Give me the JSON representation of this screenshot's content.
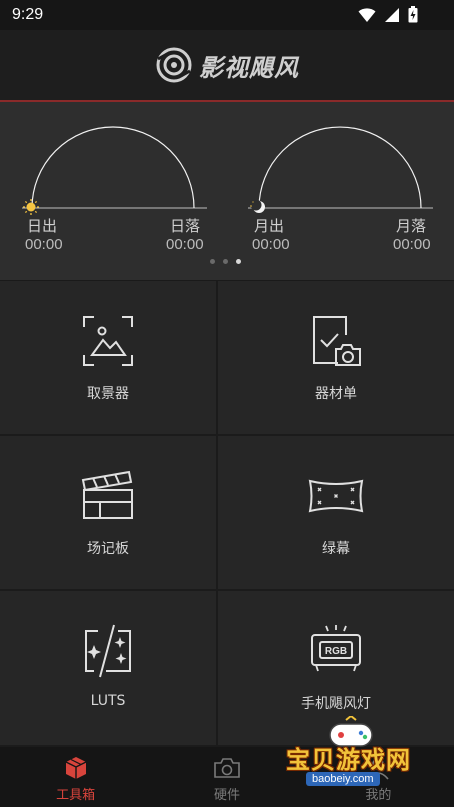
{
  "status_bar": {
    "time": "9:29",
    "icons": [
      "wifi-icon",
      "signal-icon",
      "battery-charging-icon"
    ]
  },
  "header": {
    "logo_text": "影视飓风",
    "accent_line_color": "#8a2a2a"
  },
  "sky": {
    "sun": {
      "rise_label": "日出",
      "set_label": "日落",
      "rise_time": "00:00",
      "set_time": "00:00"
    },
    "moon": {
      "rise_label": "月出",
      "set_label": "月落",
      "rise_time": "00:00",
      "set_time": "00:00"
    },
    "page_indicator": {
      "count": 3,
      "active_index": 2
    }
  },
  "tools": [
    {
      "label": "取景器",
      "icon": "viewfinder-icon"
    },
    {
      "label": "器材单",
      "icon": "gear-list-icon"
    },
    {
      "label": "场记板",
      "icon": "clapperboard-icon"
    },
    {
      "label": "绿幕",
      "icon": "green-screen-icon"
    },
    {
      "label": "LUTS",
      "icon": "luts-icon"
    },
    {
      "label": "手机飓风灯",
      "icon": "rgb-light-icon"
    }
  ],
  "bottom_nav": {
    "items": [
      {
        "label": "工具箱",
        "icon": "toolbox-icon",
        "active": true
      },
      {
        "label": "硬件",
        "icon": "camera-icon",
        "active": false
      },
      {
        "label": "我的",
        "icon": "profile-icon",
        "active": false
      }
    ],
    "active_color": "#d8443c"
  },
  "watermark": {
    "title": "宝贝游戏网",
    "url": "baobeiy.com"
  }
}
